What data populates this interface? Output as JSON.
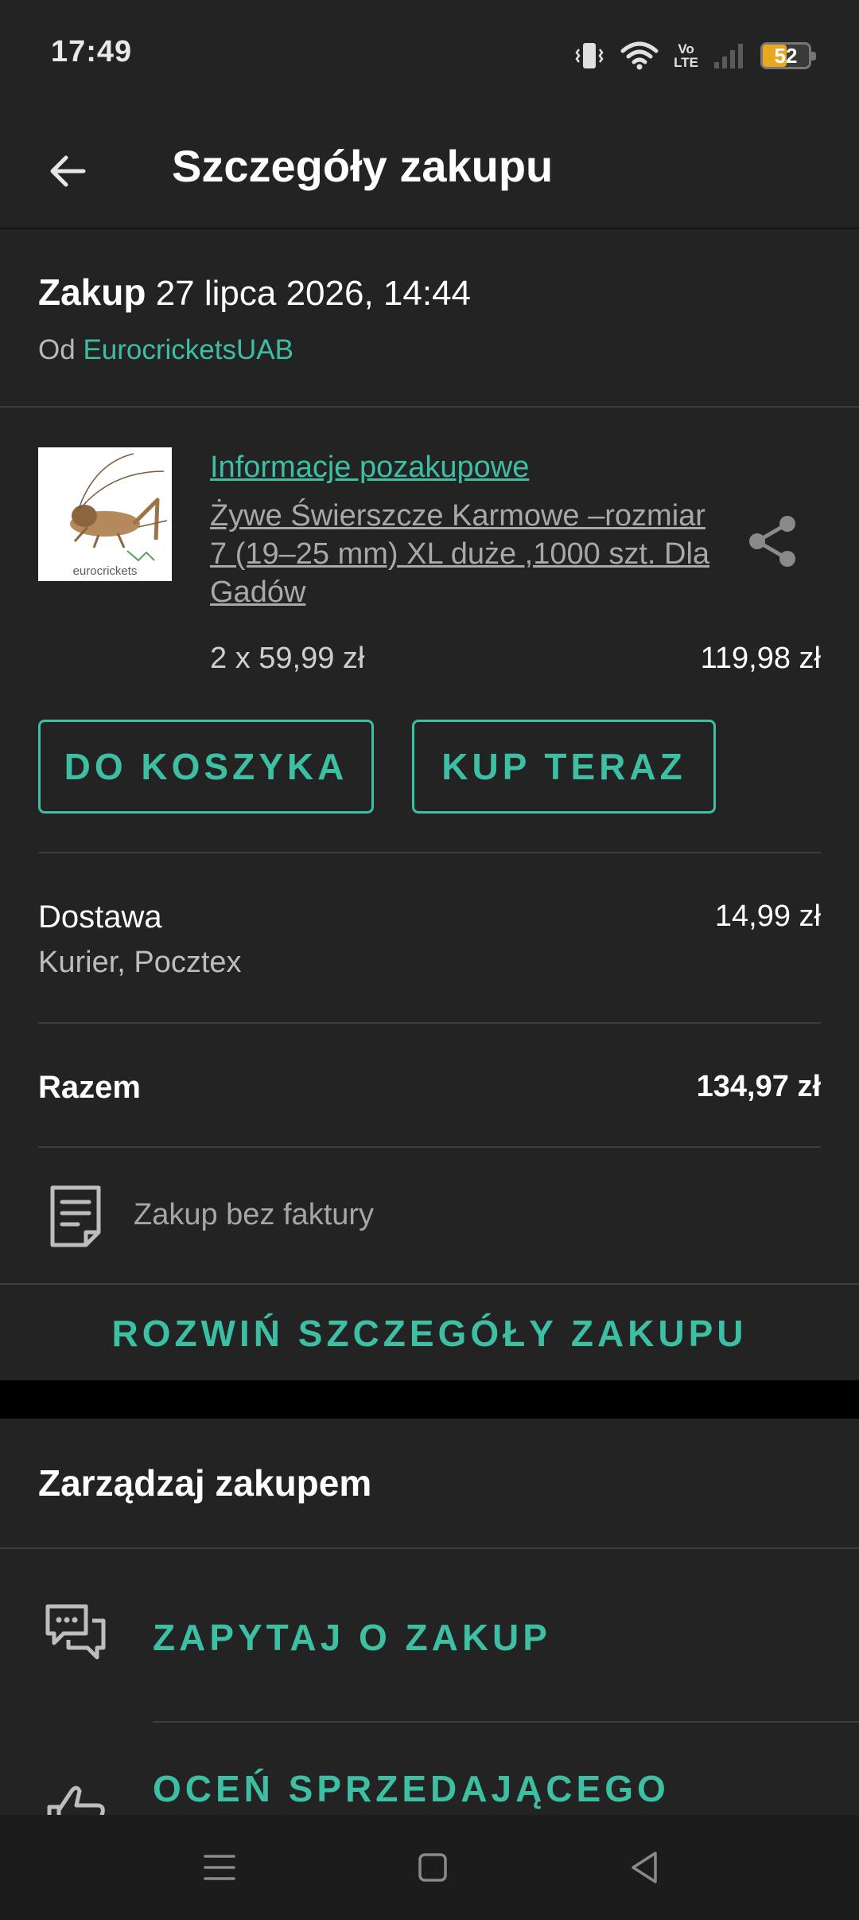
{
  "status_bar": {
    "time": "17:49",
    "volte_line1": "Vo",
    "volte_line2": "LTE",
    "battery": "52",
    "battery_level": 0.52
  },
  "app_bar": {
    "title": "Szczegóły zakupu",
    "back_icon": "arrow-left-icon"
  },
  "purchase": {
    "label": "Zakup",
    "date": "27 lipca 2026, 14:44",
    "seller_prefix": "Od",
    "seller_name": "EurocricketsUAB"
  },
  "product": {
    "post_purchase_link": "Informacje pozakupowe",
    "title": "Żywe Świerszcze Karmowe –rozmiar 7 (19–25 mm) XL duże ,1000 szt. Dla Gadów",
    "thumb_brand": "eurocrickets",
    "quantity_price": "2 x 59,99 zł",
    "line_total": "119,98 zł",
    "share_icon": "share-icon"
  },
  "buttons": {
    "add_to_cart": "DO KOSZYKA",
    "buy_now": "KUP TERAZ"
  },
  "delivery": {
    "label": "Dostawa",
    "method": "Kurier, Pocztex",
    "price": "14,99 zł"
  },
  "total": {
    "label": "Razem",
    "value": "134,97 zł"
  },
  "invoice": {
    "text": "Zakup bez faktury",
    "icon": "document-icon"
  },
  "expand_details": "ROZWIŃ SZCZEGÓŁY ZAKUPU",
  "manage": {
    "title": "Zarządzaj zakupem",
    "actions": [
      {
        "label": "ZAPYTAJ O ZAKUP",
        "icon": "chat-icon"
      },
      {
        "label": "OCEŃ SPRZEDAJĄCEGO",
        "icon": "thumbs-up-icon"
      }
    ]
  },
  "colors": {
    "accent": "#3dbfa3",
    "background": "#232323",
    "separator": "#000000"
  }
}
